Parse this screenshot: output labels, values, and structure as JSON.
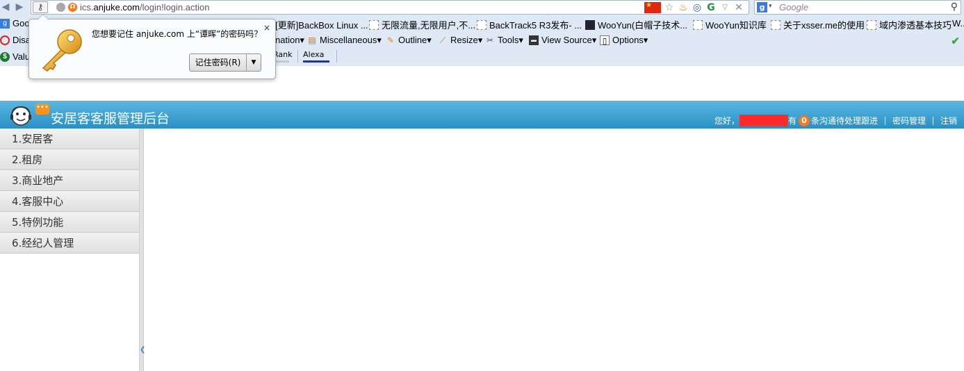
{
  "browser": {
    "url_prefix": "ics.",
    "url_host": "anjuke.com",
    "url_path": "/login!login.action",
    "search_placeholder": "Google",
    "bookmarks_row1": [
      {
        "label": "Goo",
        "icon": "google-icon"
      },
      {
        "label": "[更新]BackBox Linux ...",
        "icon": "page-icon"
      },
      {
        "label": "无限流量,无限用户,不...",
        "icon": "page-icon"
      },
      {
        "label": "BackTrack5 R3发布- ...",
        "icon": "page-icon"
      },
      {
        "label": "WooYun(白帽子技术...",
        "icon": "wooyun-icon"
      },
      {
        "label": "WooYun知识库",
        "icon": "page-icon"
      },
      {
        "label": "关于xsser.me的使用",
        "icon": "page-icon"
      },
      {
        "label": "域内渗透基本技巧",
        "icon": "page-icon"
      },
      {
        "label": "W...",
        "icon": "none"
      }
    ],
    "toolbar_row2": [
      {
        "label": "Disa",
        "icon": "disable-icon"
      },
      {
        "label": "nation▾",
        "icon": "none"
      },
      {
        "label": "Miscellaneous▾",
        "icon": "misc-icon"
      },
      {
        "label": "Outline▾",
        "icon": "pencil-icon"
      },
      {
        "label": "Resize▾",
        "icon": "ruler-icon"
      },
      {
        "label": "Tools▾",
        "icon": "tools-icon"
      },
      {
        "label": "View Source▾",
        "icon": "source-icon"
      },
      {
        "label": "Options▾",
        "icon": "options-icon"
      }
    ],
    "toolbar_row3": {
      "value_label": "Valu",
      "rank_label": "Rank",
      "alexa_label": "Alexa"
    }
  },
  "password_prompt": {
    "message": "您想要记住 anjuke.com 上“谭晖”的密码吗？",
    "button_label": "记住密码(R)",
    "close_label": "×"
  },
  "app": {
    "title": "安居客客服管理后台",
    "greeting": "您好，",
    "count_prefix": "有",
    "pending_count": "0",
    "count_suffix": "条沟通待处理跟进",
    "password_link": "密码管理",
    "logout_link": "注销",
    "menu": [
      {
        "label": "1.安居客"
      },
      {
        "label": "2.租房"
      },
      {
        "label": "3.商业地产"
      },
      {
        "label": "4.客服中心"
      },
      {
        "label": "5.特例功能"
      },
      {
        "label": "6.经纪人管理"
      }
    ]
  },
  "colors": {
    "header_top": "#5ab8e2",
    "header_bottom": "#2a8fc4",
    "badge": "#f07a1c",
    "redaction": "#ff2a2a"
  }
}
